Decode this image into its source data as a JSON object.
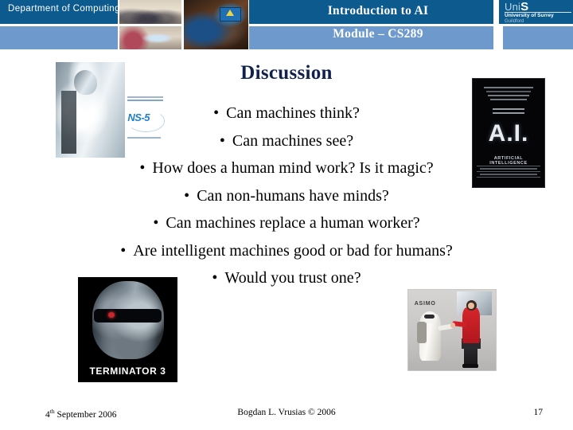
{
  "header": {
    "department": "Department of Computing",
    "title_line1": "Introduction to AI",
    "title_line2": "Module – CS289",
    "logo": {
      "mark_prefix": "Uni",
      "mark_suffix": "S",
      "university": "University of Surrey",
      "town": "Guildford"
    },
    "colors": {
      "band_dark": "#0D5A8E",
      "band_light": "#6E99CC"
    }
  },
  "slide": {
    "title": "Discussion",
    "title_color": "#10214E",
    "bullets": [
      "Can machines think?",
      "Can machines see?",
      "How does a human mind work? Is it magic?",
      "Can non-humans have minds?",
      "Can machines replace a human worker?",
      "Are intelligent machines good or bad for humans?",
      "Would you trust one?"
    ],
    "bullet_glyph": "•"
  },
  "images": {
    "nsfive": {
      "brand": "NS-5"
    },
    "ai_poster": {
      "title": "A.I.",
      "subtitle": "ARTIFICIAL INTELLIGENCE"
    },
    "terminator": {
      "title": "TERMINATOR 3"
    },
    "asimo": {
      "label": "ASIMO"
    }
  },
  "footer": {
    "date_number": "4",
    "date_ordinal": "th",
    "date_rest": " September 2006",
    "author": "Bogdan L. Vrusias © 2006",
    "page": "17"
  }
}
